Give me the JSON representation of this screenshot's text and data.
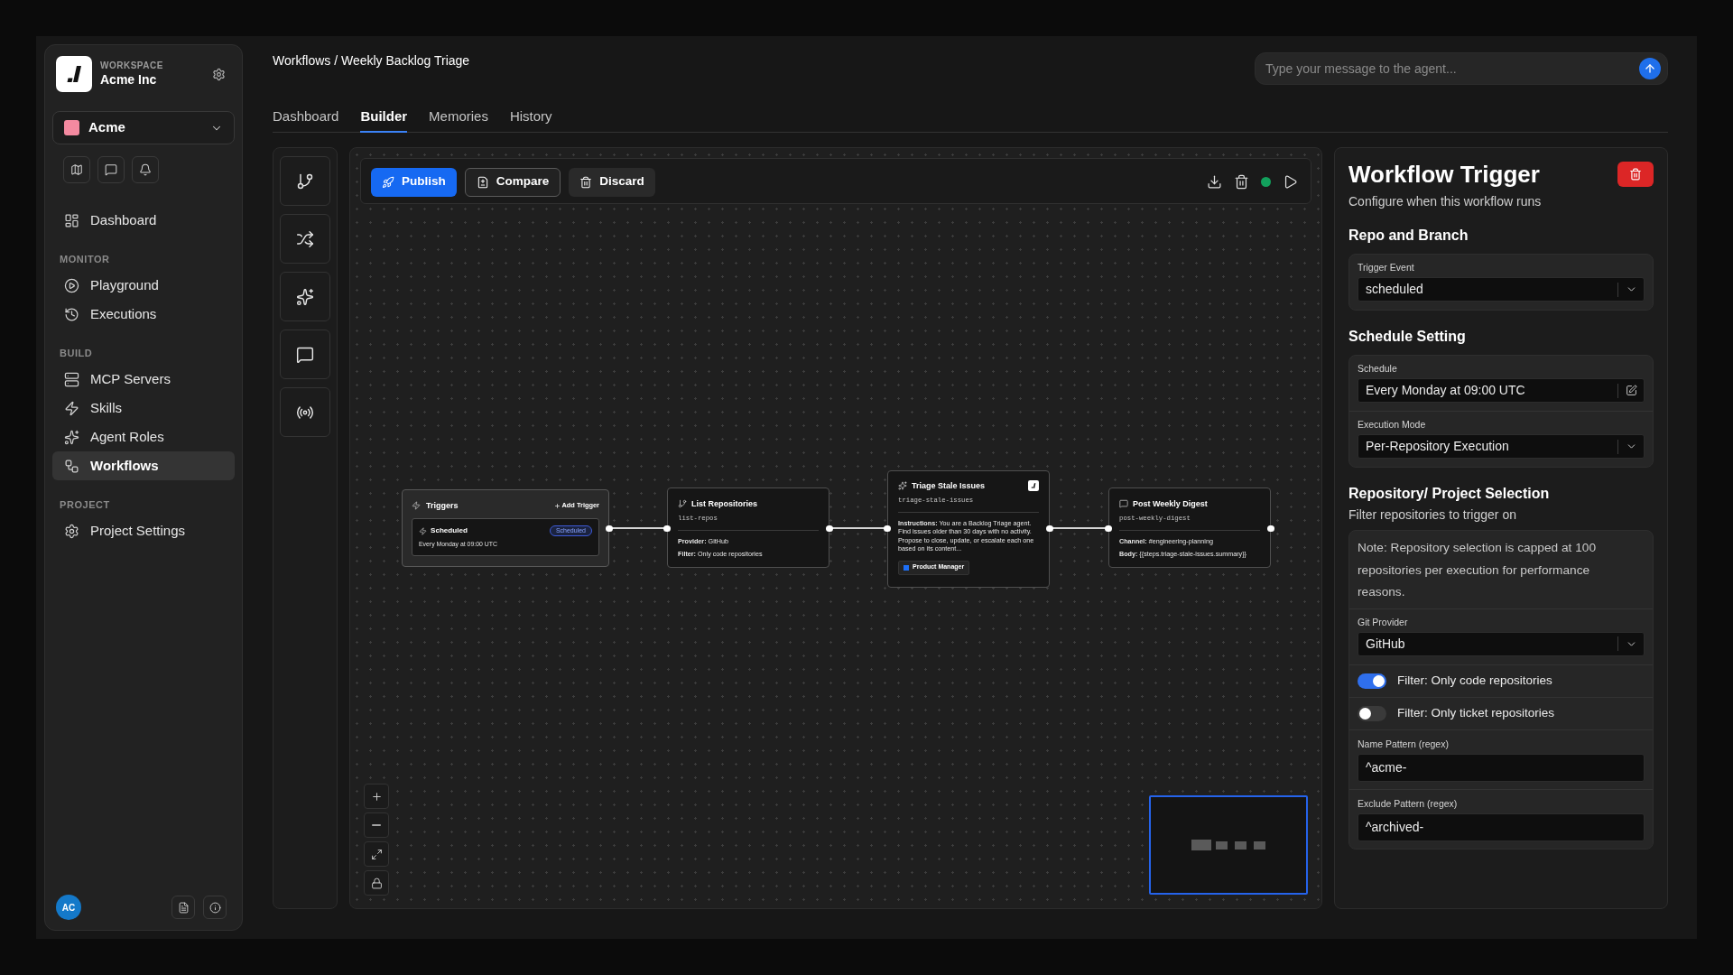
{
  "sidebar": {
    "workspace": {
      "label": "WORKSPACE",
      "name": "Acme Inc"
    },
    "project": {
      "name": "Acme"
    },
    "groups": [
      {
        "items": [
          {
            "label": "Dashboard",
            "selected": false
          }
        ]
      },
      {
        "title": "MONITOR",
        "items": [
          {
            "label": "Playground",
            "selected": false
          },
          {
            "label": "Executions",
            "selected": false
          }
        ]
      },
      {
        "title": "BUILD",
        "items": [
          {
            "label": "MCP Servers",
            "selected": false
          },
          {
            "label": "Skills",
            "selected": false
          },
          {
            "label": "Agent Roles",
            "selected": false
          },
          {
            "label": "Workflows",
            "selected": true
          }
        ]
      },
      {
        "title": "PROJECT",
        "items": [
          {
            "label": "Project Settings",
            "selected": false
          }
        ]
      }
    ],
    "user": {
      "initials": "AC"
    }
  },
  "header": {
    "breadcrumb": "Workflows / Weekly Backlog Triage",
    "chat": {
      "placeholder": "Type your message to the agent..."
    }
  },
  "tabs": [
    {
      "label": "Dashboard",
      "selected": false
    },
    {
      "label": "Builder",
      "selected": true
    },
    {
      "label": "Memories",
      "selected": false
    },
    {
      "label": "History",
      "selected": false
    }
  ],
  "canvas": {
    "toolbar": {
      "buttons": [
        {
          "label": "Publish",
          "kind": "primary"
        },
        {
          "label": "Compare",
          "kind": "outline"
        },
        {
          "label": "Discard",
          "kind": "ghost"
        }
      ]
    },
    "nodes": [
      {
        "kind": "triggers",
        "title": "Triggers",
        "action": "Add Trigger",
        "triggers": [
          {
            "title": "Scheduled",
            "badge": "Scheduled",
            "detail": "Every Monday at 09:00 UTC"
          }
        ]
      },
      {
        "kind": "step",
        "title": "List Repositories",
        "slug": "list-repos",
        "fields": [
          "**Provider:** GitHub",
          "**Filter:** Only code repositories"
        ]
      },
      {
        "kind": "agent",
        "title": "Triage Stale Issues",
        "slug": "triage-stale-issues",
        "fields": [
          "**Instructions:** You are a Backlog Triage agent. Find issues older than 30 days with no activity. Propose to close, update, or escalate each one based on its content..."
        ],
        "role": "Product Manager"
      },
      {
        "kind": "step",
        "title": "Post Weekly Digest",
        "slug": "post-weekly-digest",
        "fields": [
          "**Channel:** #engineering-planning",
          "**Body:** {{steps.triage-stale-issues.summary}}"
        ]
      }
    ]
  },
  "panel": {
    "title": "Workflow Trigger",
    "subtitle": "Configure when this workflow runs",
    "sections": [
      {
        "title": "Repo and Branch",
        "fields": [
          {
            "kind": "select",
            "label": "Trigger Event",
            "value": "scheduled"
          }
        ]
      },
      {
        "title": "Schedule Setting",
        "fields": [
          {
            "kind": "edit",
            "label": "Schedule",
            "value": "Every Monday at 09:00 UTC"
          },
          {
            "kind": "select",
            "label": "Execution Mode",
            "value": "Per-Repository Execution"
          }
        ]
      },
      {
        "title": "Repository/ Project Selection",
        "subtitle": "Filter repositories to trigger on",
        "fields": [
          {
            "kind": "note",
            "text": "Note: Repository selection is capped at 100 repositories per execution for performance reasons."
          },
          {
            "kind": "select",
            "label": "Git Provider",
            "value": "GitHub"
          },
          {
            "kind": "toggle",
            "label": "Filter: Only code repositories",
            "on": true
          },
          {
            "kind": "toggle",
            "label": "Filter: Only ticket repositories",
            "on": false
          },
          {
            "kind": "text",
            "label": "Name Pattern (regex)",
            "value": "^acme-"
          },
          {
            "kind": "text",
            "label": "Exclude Pattern (regex)",
            "value": "^archived-"
          }
        ]
      }
    ]
  }
}
